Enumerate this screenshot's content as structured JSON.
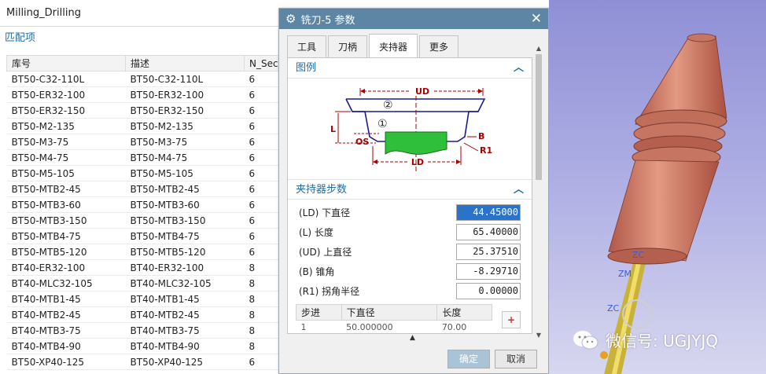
{
  "left_panel": {
    "title": "Milling_Drilling",
    "section": "匹配项",
    "columns": [
      "库号",
      "描述",
      "N_Sec"
    ],
    "rows": [
      [
        "BT50-C32-110L",
        "BT50-C32-110L",
        "6"
      ],
      [
        "BT50-ER32-100",
        "BT50-ER32-100",
        "6"
      ],
      [
        "BT50-ER32-150",
        "BT50-ER32-150",
        "6"
      ],
      [
        "BT50-M2-135",
        "BT50-M2-135",
        "6"
      ],
      [
        "BT50-M3-75",
        "BT50-M3-75",
        "6"
      ],
      [
        "BT50-M4-75",
        "BT50-M4-75",
        "6"
      ],
      [
        "BT50-M5-105",
        "BT50-M5-105",
        "6"
      ],
      [
        "BT50-MTB2-45",
        "BT50-MTB2-45",
        "6"
      ],
      [
        "BT50-MTB3-60",
        "BT50-MTB3-60",
        "6"
      ],
      [
        "BT50-MTB3-150",
        "BT50-MTB3-150",
        "6"
      ],
      [
        "BT50-MTB4-75",
        "BT50-MTB4-75",
        "6"
      ],
      [
        "BT50-MTB5-120",
        "BT50-MTB5-120",
        "6"
      ],
      [
        "BT40-ER32-100",
        "BT40-ER32-100",
        "8"
      ],
      [
        "BT40-MLC32-105",
        "BT40-MLC32-105",
        "8"
      ],
      [
        "BT40-MTB1-45",
        "BT40-MTB1-45",
        "8"
      ],
      [
        "BT40-MTB2-45",
        "BT40-MTB2-45",
        "8"
      ],
      [
        "BT40-MTB3-75",
        "BT40-MTB3-75",
        "8"
      ],
      [
        "BT40-MTB4-90",
        "BT40-MTB4-90",
        "8"
      ],
      [
        "BT50-XP40-125",
        "BT50-XP40-125",
        "6"
      ]
    ]
  },
  "dialog": {
    "title": "铣刀-5 参数",
    "tabs": [
      "工具",
      "刀柄",
      "夹持器",
      "更多"
    ],
    "active_tab": "夹持器",
    "legend_group": "图例",
    "diagram_labels": {
      "ud": "UD",
      "ld": "LD",
      "l": "L",
      "os": "OS",
      "b": "B",
      "r1": "R1",
      "c1": "①",
      "c2": "②"
    },
    "params_group": "夹持器步数",
    "params": [
      {
        "label": "(LD) 下直径",
        "value": "44.45000",
        "selected": true
      },
      {
        "label": "(L) 长度",
        "value": "65.40000",
        "selected": false
      },
      {
        "label": "(UD) 上直径",
        "value": "25.37510",
        "selected": false
      },
      {
        "label": "(B) 锥角",
        "value": "-8.29710",
        "selected": false
      },
      {
        "label": "(R1) 拐角半径",
        "value": "0.00000",
        "selected": false
      }
    ],
    "steps_columns": [
      "步进",
      "下直径",
      "长度"
    ],
    "steps_partial_row": [
      "1",
      "50.000000",
      "70.00"
    ],
    "ok_label": "确定",
    "cancel_label": "取消"
  },
  "viewport": {
    "axis_labels": [
      "ZC",
      "ZM",
      "ZC"
    ],
    "watermark": "微信号: UGJYJQ"
  }
}
